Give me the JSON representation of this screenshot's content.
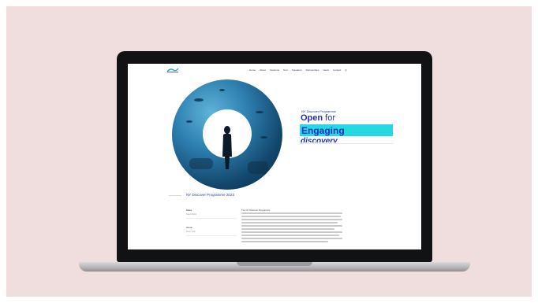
{
  "site": {
    "nav": [
      "Home",
      "About",
      "Sessions",
      "Tour",
      "Speakers",
      "Partnerships",
      "News",
      "Contact",
      "Q"
    ],
    "hero": {
      "eyebrow": "NY Discover Programme",
      "line1_bold": "Open",
      "line1_rest": " for",
      "line2": "Engaging",
      "line3": "discovery"
    },
    "section_title": "NY Discover Programme 2023",
    "sidebar": [
      {
        "label": "Dates",
        "value": "Sept 2023"
      },
      {
        "label": "Venue",
        "value": "New York"
      }
    ],
    "body_lead": "The NY Discover Programme"
  },
  "colors": {
    "background": "#efdedd",
    "accent_blue": "#1c2fc2",
    "accent_cyan": "#26d9e0"
  }
}
